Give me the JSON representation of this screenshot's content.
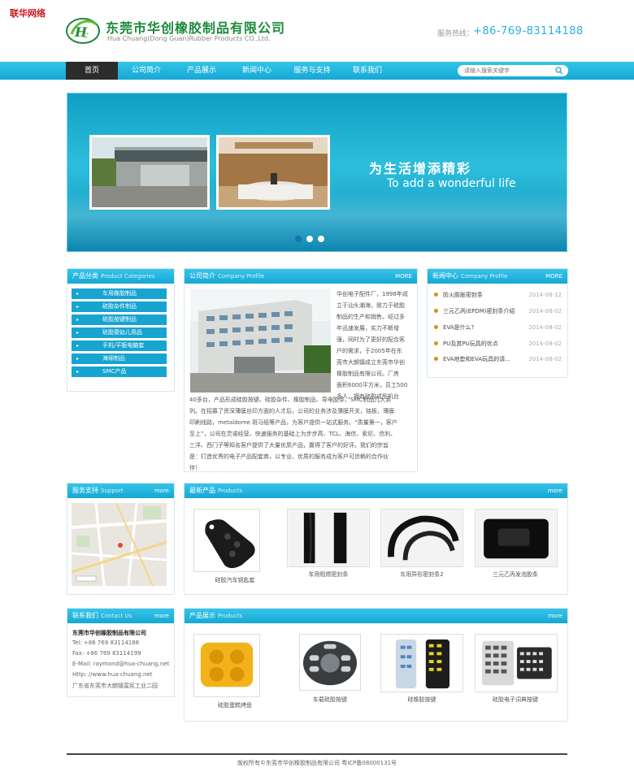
{
  "corner_label": "联华网络",
  "header": {
    "company_cn": "东莞市华创橡胶制品有限公司",
    "company_en": "Hua Chuang(Dong Guan)Rubber Products CO.,Ltd.",
    "hotline_label": "服务热线：",
    "hotline": "+86-769-83114188"
  },
  "nav": {
    "items": [
      "首页",
      "公司简介",
      "产品展示",
      "新闻中心",
      "服务与支持",
      "联系我们"
    ],
    "search_placeholder": "请输入搜索关键字"
  },
  "banner": {
    "slogan_cn": "为生活增添精彩",
    "slogan_en": "To add a wonderful life"
  },
  "categories": {
    "title": "产品分类",
    "subtitle": "Product Categories",
    "items": [
      "车用橡胶制品",
      "硅胶杂件制品",
      "硅胶按键制品",
      "硅胶婴幼儿用品",
      "手机/平板电脑套",
      "海绵制品",
      "SMC产品"
    ]
  },
  "profile": {
    "title": "公司简介",
    "subtitle": "Company Profile",
    "more": "MORE",
    "narrow_lines": [
      "华创电子配件厂，1998年成",
      "立于汕头潮海，致力于硅胶",
      "制品的生产和销售。经过多",
      "年迅速发展，实力不断增",
      "强，同时为了更好的配合客",
      "户的需求，于2005年在东",
      "莞市大朗镇成立东莞市华创",
      "橡胶制品有限公司。厂房",
      "面积6000平方米，员工500",
      "多人，拥有硅胶成型机台"
    ],
    "wide_lines": [
      "40多台，产品形成硅胶按键、硅胶杂件、橡胶制品、导电胶条、SMC制品几大系",
      "列。在招募了资深薄膜丝印方面的人才后，公司的业务涉及薄膜开关，铭板，薄膜",
      "印刷线路，metaldome 斑马纸等产品，为客户提供一站式服务。“质量第一，客户",
      "至上”，公司在灵诺经营，快速服务的基础上为步步高、TCL、海信、索尼、信利、",
      "三洋、西门子等知名客户提供了大量优质产品，赢得了客户的好评。我们的宗旨",
      "是：打造优秀的电子产品配套商，以专业、优质的服务成为客户可信赖的合作伙",
      "伴！"
    ]
  },
  "news": {
    "title": "新闻中心",
    "subtitle": "Company Profile",
    "more": "MORE",
    "items": [
      {
        "title": "防火膨胀密封条",
        "date": "2014-08-12"
      },
      {
        "title": "三元乙丙(EPDM)密封条介绍",
        "date": "2014-08-02"
      },
      {
        "title": "EVA是什么?",
        "date": "2014-08-02"
      },
      {
        "title": "PU及其PU玩具的优点",
        "date": "2014-08-02"
      },
      {
        "title": "EVA地垫和EVA玩具的请...",
        "date": "2014-08-02"
      }
    ]
  },
  "support": {
    "title": "服务支持",
    "subtitle": "Support",
    "more": "more"
  },
  "latest": {
    "title": "最新产品",
    "subtitle": "Products",
    "more": "more",
    "items": [
      "硅胶汽车钥匙套",
      "车用阻燃密封条",
      "车用异形密封条2",
      "三元乙丙发泡胶条"
    ]
  },
  "contact": {
    "title": "联系我们",
    "subtitle": "Contact Us",
    "more": "more",
    "company": "东莞市华创橡胶制品有限公司",
    "tel": "Tel: +86 769 83114188",
    "fax": "Fax: +86 769 83114199",
    "email": "E-Mail: raymond@hua-chuang.net",
    "http": "Http: //www.hua-chuang.net",
    "address": "广东省东莞市大朗镇富民工业二园"
  },
  "showcase": {
    "title": "产品展示",
    "subtitle": "Products",
    "more": "more",
    "items": [
      "硅胶蛋糕烤盘",
      "车载硅胶按键",
      "硅橡胶按键",
      "硅胶电子词典按键"
    ]
  },
  "footer": {
    "text": "版权所有©东莞市华创橡胶制品有限公司 粤ICP备08000131号"
  },
  "colors": {
    "accent": "#17a8d5",
    "brand_green": "#1a8a3a",
    "bullet_orange": "#e48a1b"
  }
}
